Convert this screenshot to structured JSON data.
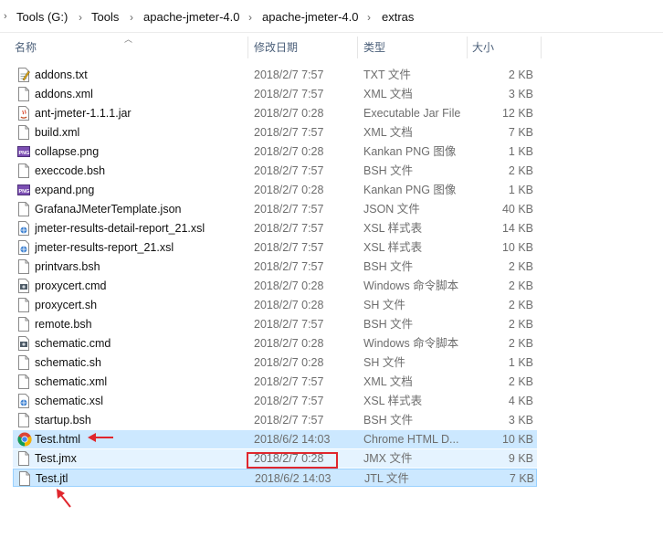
{
  "breadcrumb": [
    "Tools (G:)",
    "Tools",
    "apache-jmeter-4.0",
    "apache-jmeter-4.0",
    "extras"
  ],
  "columns": {
    "name": "名称",
    "date": "修改日期",
    "type": "类型",
    "size": "大小"
  },
  "files": [
    {
      "name": "addons.txt",
      "date": "2018/2/7 7:57",
      "type": "TXT 文件",
      "size": "2 KB",
      "icon": "text-file-icon"
    },
    {
      "name": "addons.xml",
      "date": "2018/2/7 7:57",
      "type": "XML 文档",
      "size": "3 KB",
      "icon": "blank-file-icon"
    },
    {
      "name": "ant-jmeter-1.1.1.jar",
      "date": "2018/2/7 0:28",
      "type": "Executable Jar File",
      "size": "12 KB",
      "icon": "jar-file-icon"
    },
    {
      "name": "build.xml",
      "date": "2018/2/7 7:57",
      "type": "XML 文档",
      "size": "7 KB",
      "icon": "blank-file-icon"
    },
    {
      "name": "collapse.png",
      "date": "2018/2/7 0:28",
      "type": "Kankan PNG 图像",
      "size": "1 KB",
      "icon": "image-file-icon"
    },
    {
      "name": "execcode.bsh",
      "date": "2018/2/7 7:57",
      "type": "BSH 文件",
      "size": "2 KB",
      "icon": "blank-file-icon"
    },
    {
      "name": "expand.png",
      "date": "2018/2/7 0:28",
      "type": "Kankan PNG 图像",
      "size": "1 KB",
      "icon": "image-file-icon"
    },
    {
      "name": "GrafanaJMeterTemplate.json",
      "date": "2018/2/7 7:57",
      "type": "JSON 文件",
      "size": "40 KB",
      "icon": "blank-file-icon"
    },
    {
      "name": "jmeter-results-detail-report_21.xsl",
      "date": "2018/2/7 7:57",
      "type": "XSL 样式表",
      "size": "14 KB",
      "icon": "xsl-file-icon"
    },
    {
      "name": "jmeter-results-report_21.xsl",
      "date": "2018/2/7 7:57",
      "type": "XSL 样式表",
      "size": "10 KB",
      "icon": "xsl-file-icon"
    },
    {
      "name": "printvars.bsh",
      "date": "2018/2/7 7:57",
      "type": "BSH 文件",
      "size": "2 KB",
      "icon": "blank-file-icon"
    },
    {
      "name": "proxycert.cmd",
      "date": "2018/2/7 0:28",
      "type": "Windows 命令脚本",
      "size": "2 KB",
      "icon": "cmd-file-icon"
    },
    {
      "name": "proxycert.sh",
      "date": "2018/2/7 0:28",
      "type": "SH 文件",
      "size": "2 KB",
      "icon": "blank-file-icon"
    },
    {
      "name": "remote.bsh",
      "date": "2018/2/7 7:57",
      "type": "BSH 文件",
      "size": "2 KB",
      "icon": "blank-file-icon"
    },
    {
      "name": "schematic.cmd",
      "date": "2018/2/7 0:28",
      "type": "Windows 命令脚本",
      "size": "2 KB",
      "icon": "cmd-file-icon"
    },
    {
      "name": "schematic.sh",
      "date": "2018/2/7 0:28",
      "type": "SH 文件",
      "size": "1 KB",
      "icon": "blank-file-icon"
    },
    {
      "name": "schematic.xml",
      "date": "2018/2/7 7:57",
      "type": "XML 文档",
      "size": "2 KB",
      "icon": "blank-file-icon"
    },
    {
      "name": "schematic.xsl",
      "date": "2018/2/7 7:57",
      "type": "XSL 样式表",
      "size": "4 KB",
      "icon": "xsl-file-icon"
    },
    {
      "name": "startup.bsh",
      "date": "2018/2/7 7:57",
      "type": "BSH 文件",
      "size": "3 KB",
      "icon": "blank-file-icon"
    },
    {
      "name": "Test.html",
      "date": "2018/6/2 14:03",
      "type": "Chrome HTML D...",
      "size": "10 KB",
      "icon": "chrome-icon",
      "state": "sel"
    },
    {
      "name": "Test.jmx",
      "date": "2018/2/7 0:28",
      "type": "JMX 文件",
      "size": "9 KB",
      "icon": "blank-file-icon",
      "state": "hov"
    },
    {
      "name": "Test.jtl",
      "date": "2018/6/2 14:03",
      "type": "JTL 文件",
      "size": "7 KB",
      "icon": "blank-file-icon",
      "state": "focus"
    }
  ],
  "colors": {
    "selection": "#cce8ff",
    "hover": "#e5f3ff",
    "annotation": "#e0262d"
  }
}
